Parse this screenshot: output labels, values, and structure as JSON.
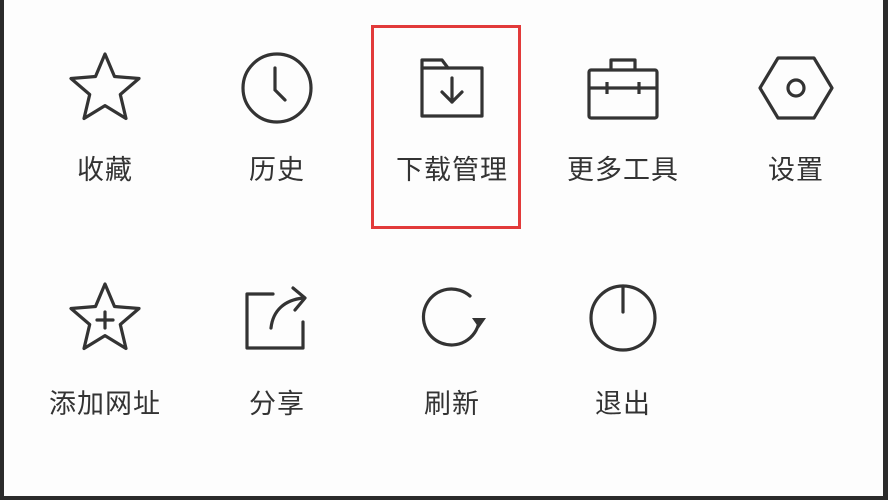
{
  "menu": {
    "row1": [
      {
        "label": "收藏",
        "icon": "star-icon"
      },
      {
        "label": "历史",
        "icon": "clock-icon"
      },
      {
        "label": "下载管理",
        "icon": "folder-download-icon"
      },
      {
        "label": "更多工具",
        "icon": "toolbox-icon"
      },
      {
        "label": "设置",
        "icon": "hexagon-settings-icon"
      }
    ],
    "row2": [
      {
        "label": "添加网址",
        "icon": "star-plus-icon"
      },
      {
        "label": "分享",
        "icon": "share-icon"
      },
      {
        "label": "刷新",
        "icon": "refresh-icon"
      },
      {
        "label": "退出",
        "icon": "power-icon"
      }
    ]
  },
  "highlight": {
    "target": "下载管理",
    "color": "#e23a3a"
  },
  "colors": {
    "icon_stroke": "#333333",
    "text": "#333333",
    "background": "#ffffff"
  }
}
